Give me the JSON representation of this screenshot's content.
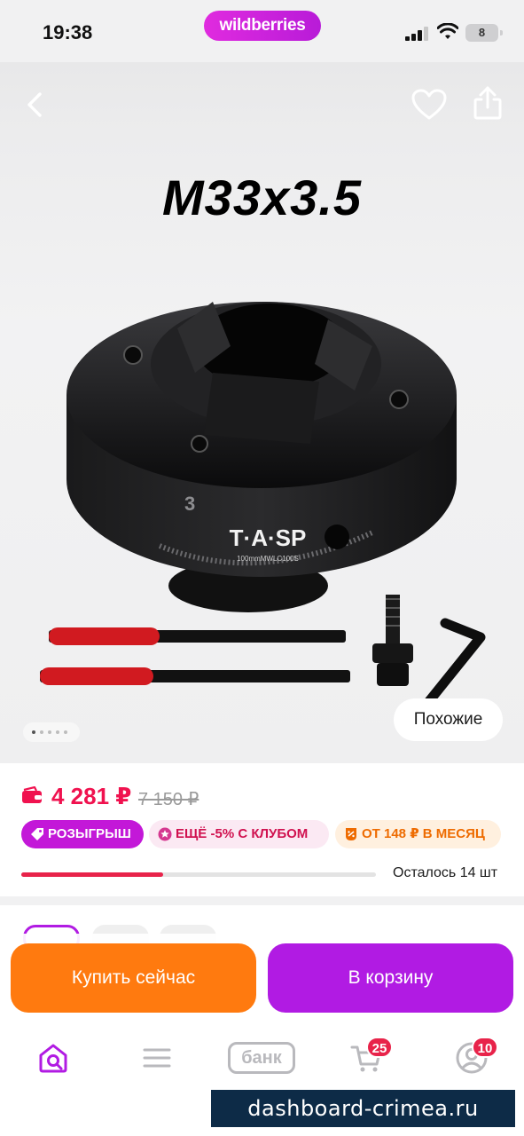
{
  "status_bar": {
    "time": "19:38",
    "app_pill": "wildberries",
    "battery": "8"
  },
  "gallery": {
    "thread_label": "M33x3.5",
    "brand_mark": "T·A·SP",
    "model_mark": "100mmMWLC100S",
    "chuck_number": "3",
    "similar_button": "Похожие",
    "pager_total": 5
  },
  "price": {
    "current": "4 281 ₽",
    "old": "7 150 ₽"
  },
  "badges": [
    {
      "label": "РОЗЫГРЫШ",
      "icon": "tag-icon"
    },
    {
      "label": "ЕЩЁ -5% С КЛУБОМ",
      "icon": "club-icon"
    },
    {
      "label": "ОТ 148 ₽ В МЕСЯЦ",
      "icon": "split-icon"
    }
  ],
  "stock": {
    "text": "Осталось 14 шт",
    "fill_fraction": 0.4
  },
  "actions": {
    "buy_now": "Купить сейчас",
    "to_cart": "В корзину"
  },
  "tabbar": {
    "bank_label": "банк",
    "cart_count": "25",
    "profile_count": "10"
  },
  "colors": {
    "accent": "#b11be3",
    "buy_now": "#ff7a0f",
    "price": "#f0124f",
    "badge_red": "#e8234a"
  },
  "watermark": "dashboard-crimea.ru"
}
